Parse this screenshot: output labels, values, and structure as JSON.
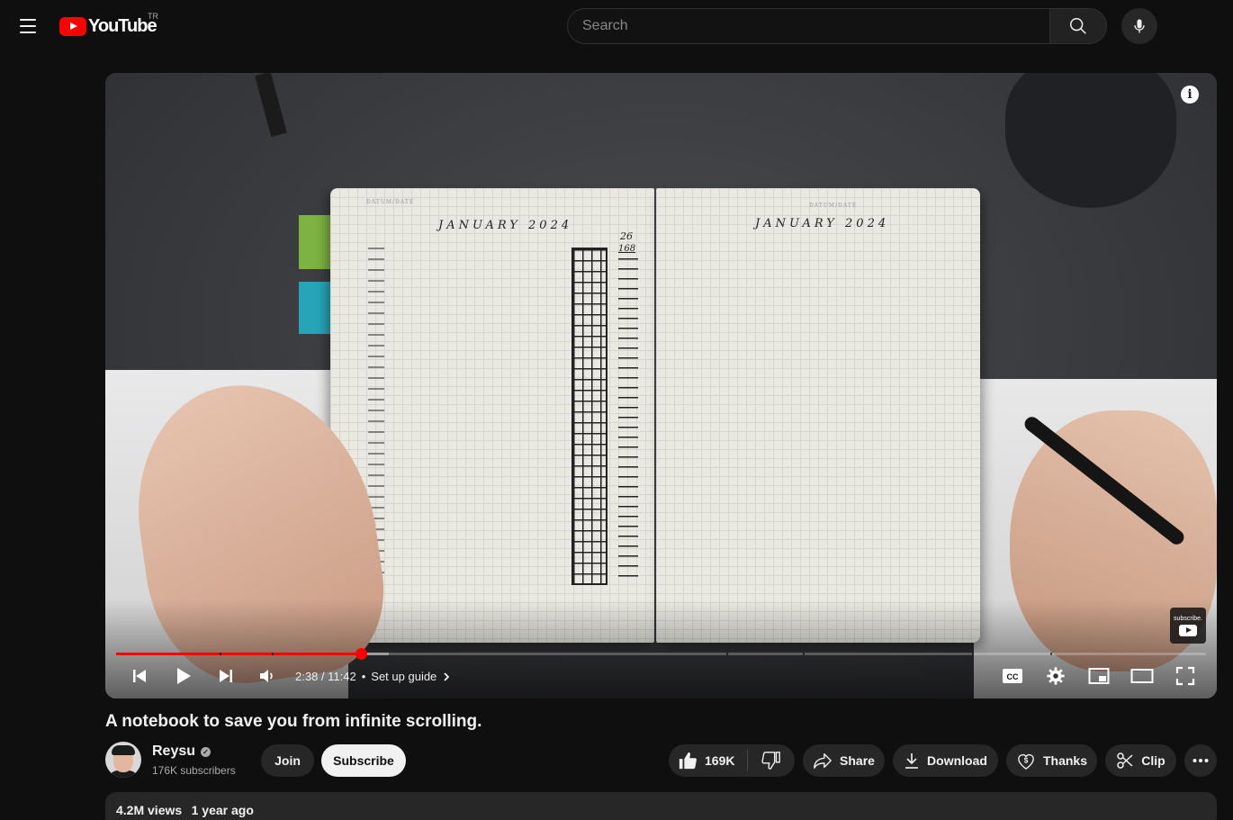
{
  "masthead": {
    "logo_text": "YouTube",
    "region": "TR",
    "search_placeholder": "Search"
  },
  "player": {
    "current_time": "2:38",
    "duration": "11:42",
    "time_display": "2:38 / 11:42",
    "chapter_title": "Set up guide",
    "played_fraction": 0.225,
    "loaded_fraction": 0.25,
    "chapter_markers": [
      0.095,
      0.143,
      0.56,
      0.63,
      0.785,
      0.857
    ],
    "watermark_text": "subscribe.",
    "accent_color": "#ff0000",
    "notebook_text": {
      "left_heading": "JANUARY   2024",
      "right_heading": "JANUARY   2024",
      "small_header": "DATUM/DATE",
      "column_top": "26",
      "column_sub": "168"
    }
  },
  "video": {
    "title": "A notebook to save you from infinite scrolling.",
    "channel_name": "Reysu",
    "subscribers": "176K subscribers",
    "join_label": "Join",
    "subscribe_label": "Subscribe",
    "likes": "169K",
    "share_label": "Share",
    "download_label": "Download",
    "thanks_label": "Thanks",
    "clip_label": "Clip",
    "views": "4.2M views",
    "uploaded": "1 year ago"
  },
  "icons": {
    "menu": "hamburger-icon",
    "search": "search-icon",
    "mic": "microphone-icon",
    "info": "info-icon",
    "prev": "previous-icon",
    "play": "play-icon",
    "next": "next-icon",
    "volume": "volume-icon",
    "captions": "cc-icon",
    "settings": "gear-icon",
    "miniplayer": "miniplayer-icon",
    "theater": "theater-icon",
    "fullscreen": "fullscreen-icon",
    "like": "thumbs-up-icon",
    "dislike": "thumbs-down-icon",
    "share": "share-icon",
    "download": "download-icon",
    "thanks": "thanks-icon",
    "clip": "scissors-icon",
    "more": "more-icon"
  }
}
